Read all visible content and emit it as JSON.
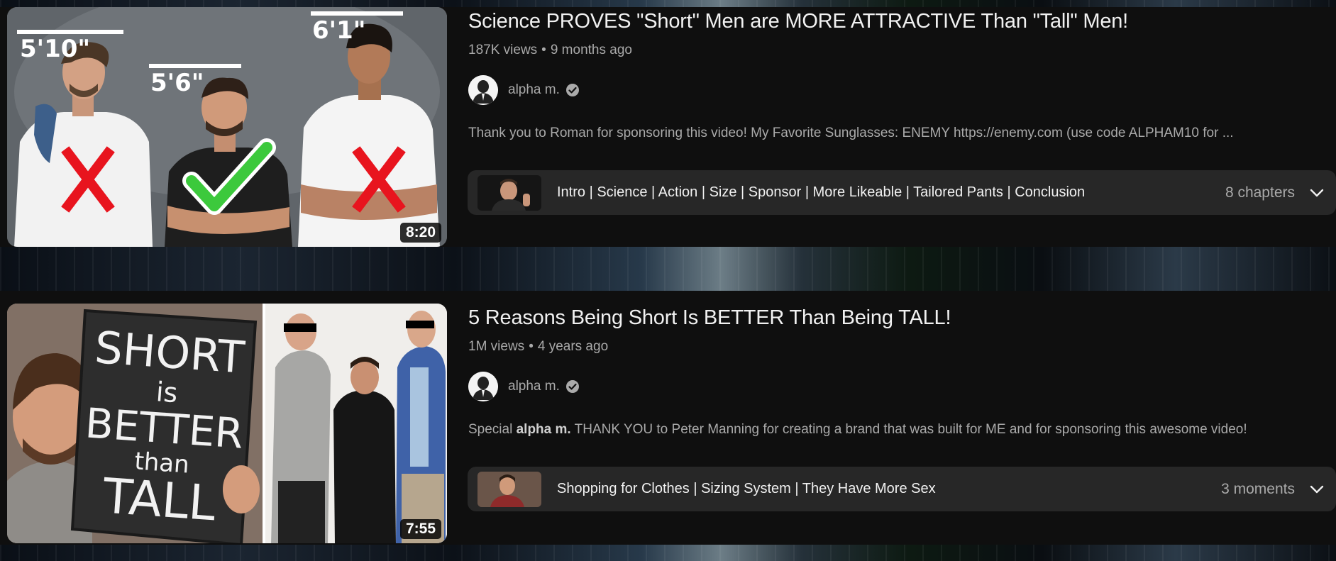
{
  "videos": [
    {
      "title": "Science PROVES \"Short\" Men are MORE ATTRACTIVE Than \"Tall\" Men!",
      "views": "187K views",
      "age": "9 months ago",
      "channel": "alpha m.",
      "description": "Thank you to Roman for sponsoring this video! My Favorite Sunglasses: ENEMY https://enemy.com (use code ALPHAM10 for ...",
      "duration": "8:20",
      "chapters_text": "Intro | Science | Action | Size | Sponsor | More Likeable | Tailored Pants | Conclusion",
      "chapters_count": "8 chapters",
      "thumbnail_labels": [
        "5'10\"",
        "5'6\"",
        "6'1\""
      ]
    },
    {
      "title": "5 Reasons Being Short Is BETTER Than Being TALL!",
      "views": "1M views",
      "age": "4 years ago",
      "channel": "alpha m.",
      "description_prefix": "Special ",
      "description_bold": "alpha m.",
      "description_rest": " THANK YOU to Peter Manning for creating a brand that was built for ME and for sponsoring this awesome video!",
      "duration": "7:55",
      "chapters_text": "Shopping for Clothes | Sizing System | They Have More Sex",
      "chapters_count": "3 moments",
      "sign_lines": [
        "SHORT",
        "is",
        "BETTER",
        "than",
        "TALL"
      ]
    }
  ],
  "icons": {
    "verified": "verified-check-icon",
    "expand": "chevron-down-icon",
    "cross": "red-x-icon",
    "check": "green-check-icon"
  },
  "colors": {
    "background": "#0f0f0f",
    "chapters_bar": "#272727",
    "meta_text": "#aaaaaa",
    "check_green": "#3cc93c",
    "cross_red": "#e8141e"
  }
}
